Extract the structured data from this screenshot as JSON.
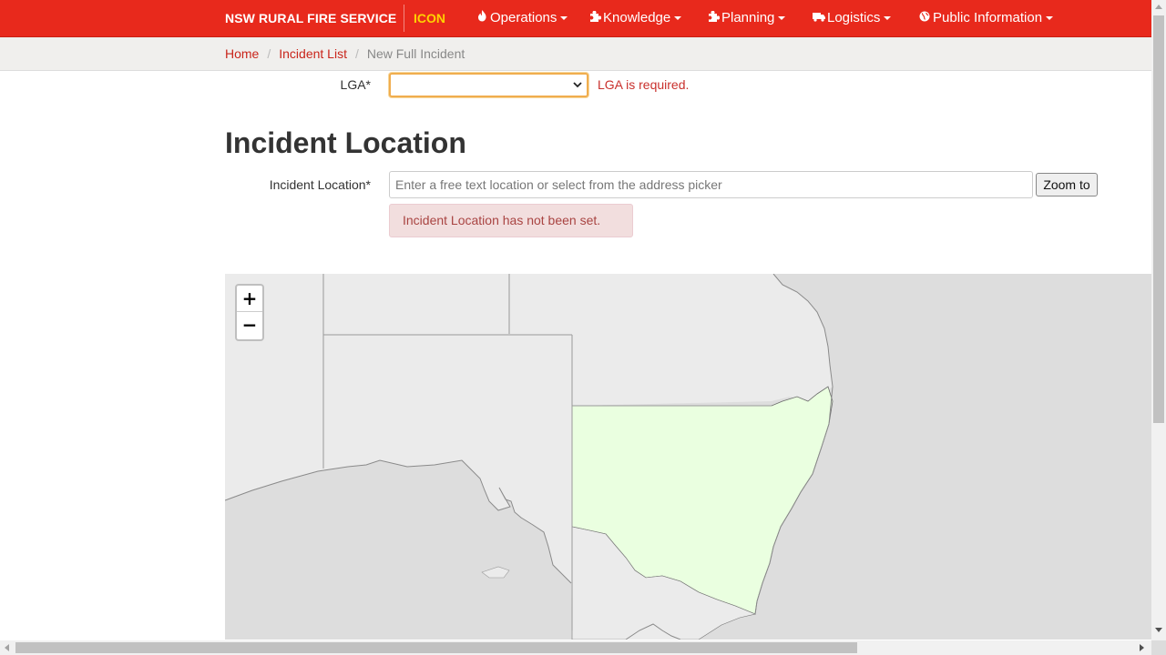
{
  "navbar": {
    "brand": "NSW RURAL FIRE SERVICE",
    "app_name": "ICON",
    "items": [
      {
        "label": "Operations",
        "icon": "fire-icon"
      },
      {
        "label": "Knowledge",
        "icon": "puzzle-icon"
      },
      {
        "label": "Planning",
        "icon": "puzzle-icon"
      },
      {
        "label": "Logistics",
        "icon": "truck-icon"
      },
      {
        "label": "Public Information",
        "icon": "globe-icon"
      }
    ]
  },
  "breadcrumb": {
    "home": "Home",
    "incident_list": "Incident List",
    "current": "New Full Incident"
  },
  "form": {
    "lga_label": "LGA*",
    "lga_value": "",
    "lga_error": "LGA is required.",
    "section_title": "Incident Location",
    "location_label": "Incident Location*",
    "location_value": "",
    "location_placeholder": "Enter a free text location or select from the address picker",
    "zoom_button": "Zoom to",
    "location_error": "Incident Location has not been set."
  },
  "map": {
    "zoom_in": "+",
    "zoom_out": "−",
    "highlight_color": "#eaffe0",
    "land_color": "#ebebeb",
    "sea_color": "#dddddd"
  },
  "colors": {
    "navbar": "#e8291c",
    "app_name": "#ffd200",
    "link": "#c9251b",
    "error": "#c9302c"
  }
}
